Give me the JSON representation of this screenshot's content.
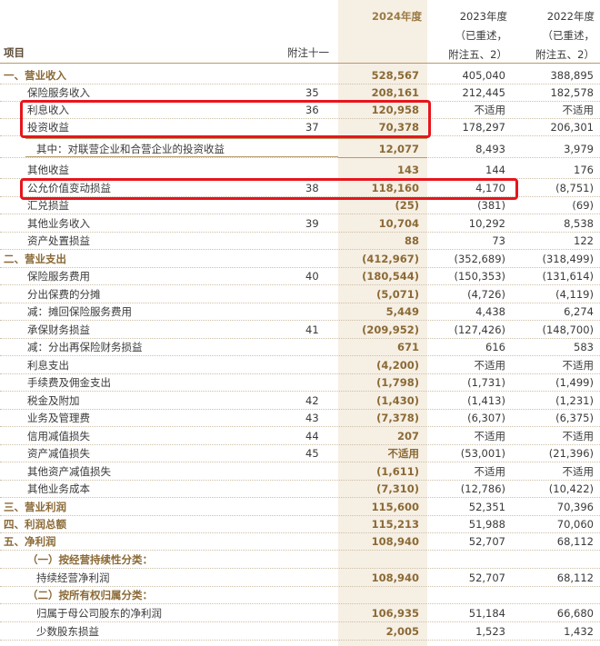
{
  "header": {
    "label": "项目",
    "note": "附注十一",
    "y2024": "2024年度",
    "y2023": [
      "2023年度",
      "（已重述，",
      "附注五、2）"
    ],
    "y2022": [
      "2022年度",
      "（已重述，",
      "附注五、2）"
    ]
  },
  "colors": {
    "accent": "#8b6a36",
    "highlight_col": "#f6efe4",
    "red_box": "#e8151c"
  },
  "rows": [
    {
      "name": "一、营业收入",
      "note": "",
      "v2024": "528,567",
      "v2023": "405,040",
      "v2022": "388,895",
      "style": "sec"
    },
    {
      "name": "保险服务收入",
      "note": "35",
      "v2024": "208,161",
      "v2023": "212,445",
      "v2022": "182,578",
      "style": ""
    },
    {
      "name": "利息收入",
      "note": "36",
      "v2024": "120,958",
      "v2023": "不适用",
      "v2022": "不适用",
      "style": ""
    },
    {
      "name": "投资收益",
      "note": "37",
      "v2024": "70,378",
      "v2023": "178,297",
      "v2022": "206,301",
      "style": ""
    },
    {
      "name": "其中：对联营企业和合营企业的投资收益",
      "note": "",
      "v2024": "12,077",
      "v2023": "8,493",
      "v2022": "3,979",
      "style": "d2"
    },
    {
      "name": "其他收益",
      "note": "",
      "v2024": "143",
      "v2023": "144",
      "v2022": "176",
      "style": ""
    },
    {
      "name": "公允价值变动损益",
      "note": "38",
      "v2024": "118,160",
      "v2023": "4,170",
      "v2022": "(8,751)",
      "style": ""
    },
    {
      "name": "汇兑损益",
      "note": "",
      "v2024": "(25)",
      "v2023": "(381)",
      "v2022": "(69)",
      "style": ""
    },
    {
      "name": "其他业务收入",
      "note": "39",
      "v2024": "10,704",
      "v2023": "10,292",
      "v2022": "8,538",
      "style": ""
    },
    {
      "name": "资产处置损益",
      "note": "",
      "v2024": "88",
      "v2023": "73",
      "v2022": "122",
      "style": ""
    },
    {
      "name": "二、营业支出",
      "note": "",
      "v2024": "(412,967)",
      "v2023": "(352,689)",
      "v2022": "(318,499)",
      "style": "sec"
    },
    {
      "name": "保险服务费用",
      "note": "40",
      "v2024": "(180,544)",
      "v2023": "(150,353)",
      "v2022": "(131,614)",
      "style": ""
    },
    {
      "name": "分出保费的分摊",
      "note": "",
      "v2024": "(5,071)",
      "v2023": "(4,726)",
      "v2022": "(4,119)",
      "style": ""
    },
    {
      "name": "减：摊回保险服务费用",
      "note": "",
      "v2024": "5,449",
      "v2023": "4,438",
      "v2022": "6,274",
      "style": ""
    },
    {
      "name": "承保财务损益",
      "note": "41",
      "v2024": "(209,952)",
      "v2023": "(127,426)",
      "v2022": "(148,700)",
      "style": ""
    },
    {
      "name": "减：分出再保险财务损益",
      "note": "",
      "v2024": "671",
      "v2023": "616",
      "v2022": "583",
      "style": ""
    },
    {
      "name": "利息支出",
      "note": "",
      "v2024": "(4,200)",
      "v2023": "不适用",
      "v2022": "不适用",
      "style": ""
    },
    {
      "name": "手续费及佣金支出",
      "note": "",
      "v2024": "(1,798)",
      "v2023": "(1,731)",
      "v2022": "(1,499)",
      "style": ""
    },
    {
      "name": "税金及附加",
      "note": "42",
      "v2024": "(1,430)",
      "v2023": "(1,413)",
      "v2022": "(1,231)",
      "style": ""
    },
    {
      "name": "业务及管理费",
      "note": "43",
      "v2024": "(7,378)",
      "v2023": "(6,307)",
      "v2022": "(6,375)",
      "style": ""
    },
    {
      "name": "信用减值损失",
      "note": "44",
      "v2024": "207",
      "v2023": "不适用",
      "v2022": "不适用",
      "style": ""
    },
    {
      "name": "资产减值损失",
      "note": "45",
      "v2024": "不适用",
      "v2023": "(53,001)",
      "v2022": "(21,396)",
      "style": ""
    },
    {
      "name": "其他资产减值损失",
      "note": "",
      "v2024": "(1,611)",
      "v2023": "不适用",
      "v2022": "不适用",
      "style": ""
    },
    {
      "name": "其他业务成本",
      "note": "",
      "v2024": "(7,310)",
      "v2023": "(12,786)",
      "v2022": "(10,422)",
      "style": ""
    },
    {
      "name": "三、营业利润",
      "note": "",
      "v2024": "115,600",
      "v2023": "52,351",
      "v2022": "70,396",
      "style": "sec"
    },
    {
      "name": "四、利润总额",
      "note": "",
      "v2024": "115,213",
      "v2023": "51,988",
      "v2022": "70,060",
      "style": "sec"
    },
    {
      "name": "五、净利润",
      "note": "",
      "v2024": "108,940",
      "v2023": "52,707",
      "v2022": "68,112",
      "style": "sec"
    },
    {
      "name": "（一）按经营持续性分类：",
      "note": "",
      "v2024": "",
      "v2023": "",
      "v2022": "",
      "style": "sub"
    },
    {
      "name": "持续经营净利润",
      "note": "",
      "v2024": "108,940",
      "v2023": "52,707",
      "v2022": "68,112",
      "style": "d2"
    },
    {
      "name": "（二）按所有权归属分类：",
      "note": "",
      "v2024": "",
      "v2023": "",
      "v2022": "",
      "style": "sub"
    },
    {
      "name": "归属于母公司股东的净利润",
      "note": "",
      "v2024": "106,935",
      "v2023": "51,184",
      "v2022": "66,680",
      "style": "d2"
    },
    {
      "name": "少数股东损益",
      "note": "",
      "v2024": "2,005",
      "v2023": "1,523",
      "v2022": "1,432",
      "style": "d2"
    }
  ]
}
